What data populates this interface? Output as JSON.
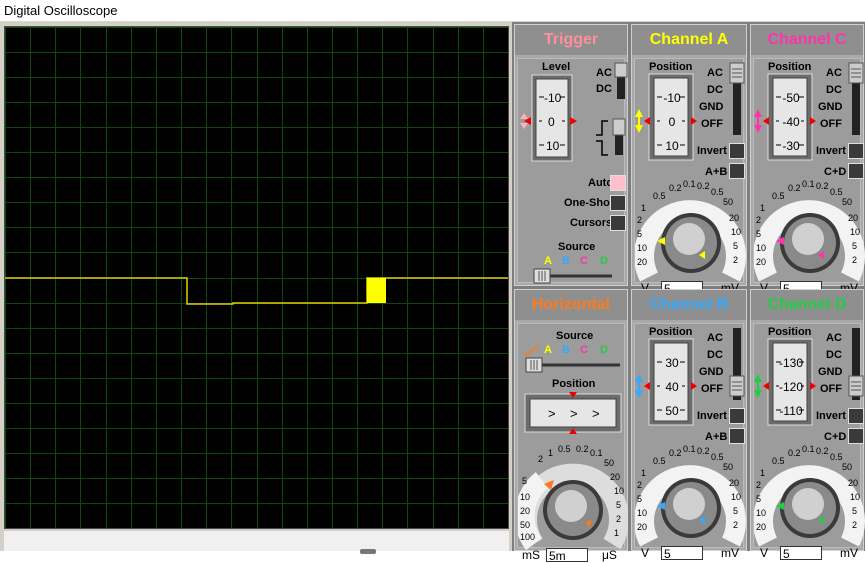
{
  "window": {
    "title": "Digital Oscilloscope"
  },
  "colors": {
    "trace": "#ffff00",
    "grid": "#0b4a0b",
    "A": "#ffff00",
    "B": "#33aaff",
    "C": "#ff33aa",
    "D": "#22cc44",
    "trigger": "#ff8f9a",
    "horizontal": "#ff7a1a"
  },
  "trigger": {
    "title": "Trigger",
    "level_label": "Level",
    "scale": [
      "-10",
      "0",
      "10"
    ],
    "coupling": [
      "AC",
      "DC"
    ],
    "modes": [
      "Auto",
      "One-Shot",
      "Cursors"
    ],
    "source_label": "Source",
    "sources": [
      "A",
      "B",
      "C",
      "D"
    ]
  },
  "horizontal": {
    "title": "Horizontal",
    "source_label": "Source",
    "sources": [
      "A",
      "B",
      "C",
      "D"
    ],
    "position_label": "Position",
    "dial_labels": [
      "2",
      "1",
      "0.5",
      "0.2",
      "0.1",
      "50",
      "20",
      "10",
      "5",
      "2",
      "1",
      "0.5",
      "0.2",
      "0.1",
      "5",
      "10",
      "20",
      "50",
      "100",
      "200"
    ],
    "units_left": "mS",
    "units_right": "μS",
    "value": "5m"
  },
  "channels": [
    {
      "key": "A",
      "title": "Channel A",
      "position_label": "Position",
      "scale": [
        "-10",
        "0",
        "10"
      ],
      "modes": [
        "AC",
        "DC",
        "GND",
        "OFF"
      ],
      "invert": "Invert",
      "sum": "A+B",
      "unit_left": "V",
      "unit_right": "mV",
      "value": "5"
    },
    {
      "key": "C",
      "title": "Channel C",
      "position_label": "Position",
      "scale": [
        "-50",
        "-40",
        "-30"
      ],
      "modes": [
        "AC",
        "DC",
        "GND",
        "OFF"
      ],
      "invert": "Invert",
      "sum": "C+D",
      "unit_left": "V",
      "unit_right": "mV",
      "value": "5"
    },
    {
      "key": "B",
      "title": "Channel B",
      "position_label": "Position",
      "scale": [
        "30",
        "40",
        "50"
      ],
      "modes": [
        "AC",
        "DC",
        "GND",
        "OFF"
      ],
      "invert": "Invert",
      "sum": "A+B",
      "unit_left": "V",
      "unit_right": "mV",
      "value": "5"
    },
    {
      "key": "D",
      "title": "Channel D",
      "position_label": "Position",
      "scale": [
        "-130",
        "-120",
        "-110"
      ],
      "modes": [
        "AC",
        "DC",
        "GND",
        "OFF"
      ],
      "invert": "Invert",
      "sum": "C+D",
      "unit_left": "V",
      "unit_right": "mV",
      "value": "5"
    }
  ],
  "dial_labels": [
    "0.5",
    "0.2",
    "0.1",
    "50",
    "20",
    "10",
    "5",
    "2",
    "1",
    "0.5",
    "0.2",
    "0.1",
    "50",
    "20",
    "10",
    "5",
    "2",
    "1"
  ]
}
